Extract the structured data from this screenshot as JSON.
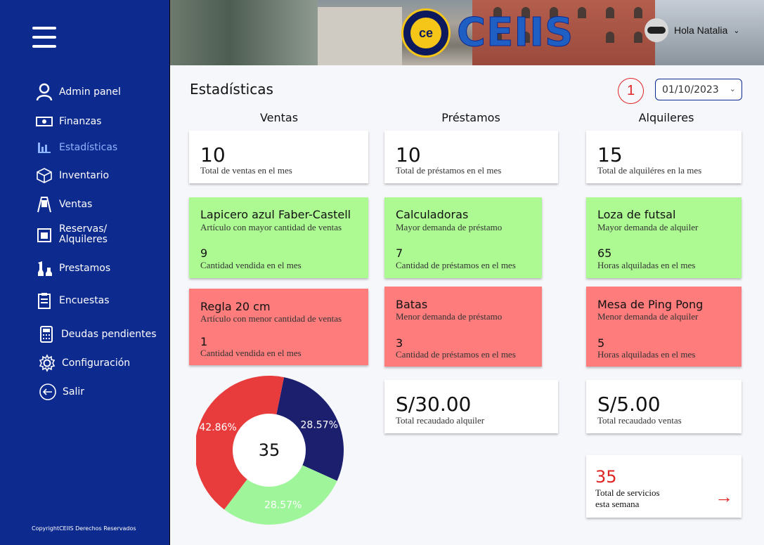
{
  "sidebar": {
    "items": [
      {
        "label": "Admin panel"
      },
      {
        "label": "Finanzas"
      },
      {
        "label": "Estadísticas"
      },
      {
        "label": "Inventario"
      },
      {
        "label": "Ventas"
      },
      {
        "label": "Reservas/",
        "label2": "Alquileres"
      },
      {
        "label": "Prestamos"
      },
      {
        "label": "Encuestas"
      },
      {
        "label": "Deudas pendientes"
      },
      {
        "label": "Configuración"
      },
      {
        "label": "Salir"
      }
    ],
    "copyright": "CopyrightCEIIS Derechos Reservados"
  },
  "header": {
    "brand": "CEIIS",
    "logo_text": "ce",
    "user_greeting": "Hola Natalia"
  },
  "main": {
    "title": "Estadísticas",
    "badge": "1",
    "date": "01/10/2023",
    "columns": {
      "ventas": {
        "title": "Ventas",
        "total_value": "10",
        "total_label": "Total de ventas en el mes",
        "top_name": "Lapicero azul Faber-Castell",
        "top_desc": "Artículo con mayor cantidad de ventas",
        "top_qty": "9",
        "top_qty_label": "Cantidad vendida en el mes",
        "low_name": "Regla 20 cm",
        "low_desc": "Artículo con menor cantidad de ventas",
        "low_qty": "1",
        "low_qty_label": "Cantidad vendida en el mes"
      },
      "prestamos": {
        "title": "Préstamos",
        "total_value": "10",
        "total_label": "Total de préstamos en el mes",
        "top_name": "Calculadoras",
        "top_desc": "Mayor demanda de préstamo",
        "top_qty": "7",
        "top_qty_label": "Cantidad de préstamos en el mes",
        "low_name": "Batas",
        "low_desc": "Menor demanda de préstamo",
        "low_qty": "3",
        "low_qty_label": "Cantidad de préstamos en el mes",
        "money": "S/30.00",
        "money_label": "Total recaudado alquiler"
      },
      "alquileres": {
        "title": "Alquileres",
        "total_value": "15",
        "total_label": "Total de alquiléres en la mes",
        "top_name": "Loza de futsal",
        "top_desc": "Mayor demanda de alquiler",
        "top_qty": "65",
        "top_qty_label": "Horas alquiladas en el mes",
        "low_name": "Mesa de Ping Pong",
        "low_desc": "Menor demanda de alquiler",
        "low_qty": "5",
        "low_qty_label": "Horas alquiladas en el mes",
        "money": "S/5.00",
        "money_label": "Total recaudado ventas"
      }
    },
    "services": {
      "value": "35",
      "label1": "Total de servicios",
      "label2": "esta semana"
    }
  },
  "chart_data": {
    "type": "pie",
    "center_label": "35",
    "slices": [
      {
        "value": 28.57,
        "label": "28.57%",
        "color": "#1b1f6e"
      },
      {
        "value": 28.57,
        "label": "28.57%",
        "color": "#9ef59a"
      },
      {
        "value": 42.86,
        "label": "42.86%",
        "color": "#e83c3c"
      }
    ]
  }
}
